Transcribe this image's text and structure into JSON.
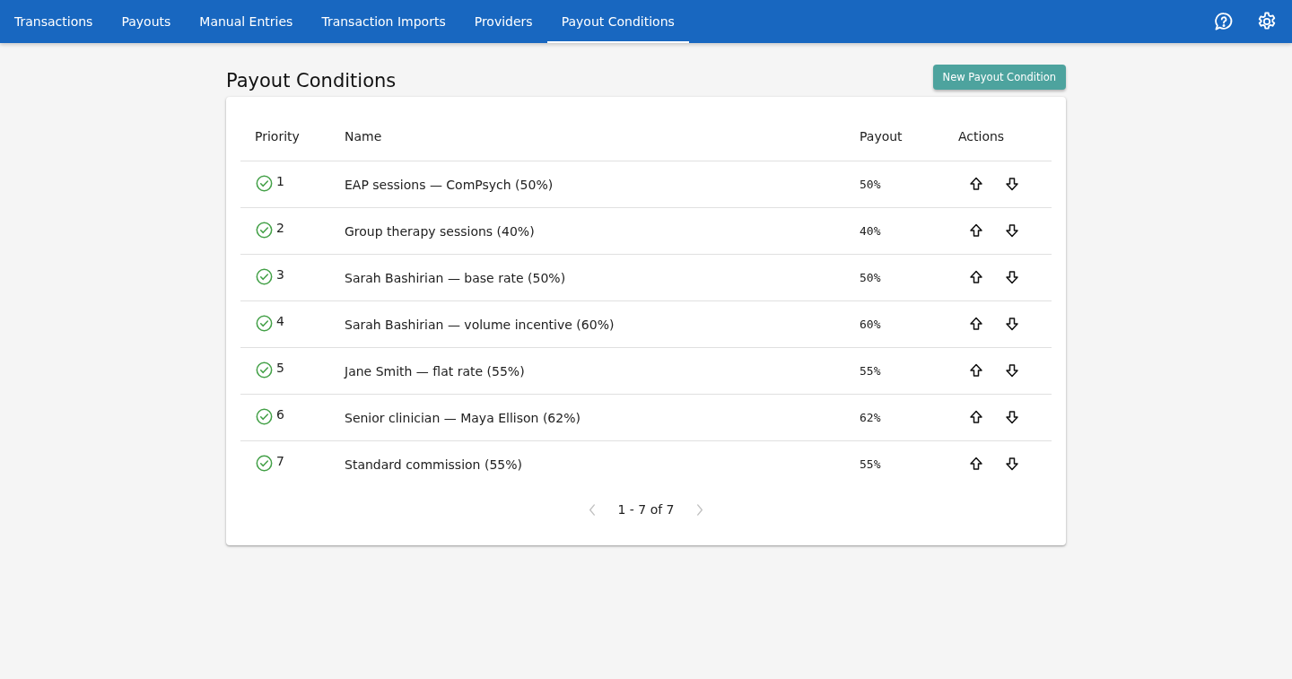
{
  "nav": {
    "tabs": [
      {
        "label": "Transactions",
        "selected": false
      },
      {
        "label": "Payouts",
        "selected": false
      },
      {
        "label": "Manual Entries",
        "selected": false
      },
      {
        "label": "Transaction Imports",
        "selected": false
      },
      {
        "label": "Providers",
        "selected": false
      },
      {
        "label": "Payout Conditions",
        "selected": true
      }
    ]
  },
  "page": {
    "title": "Payout Conditions",
    "new_button": "New Payout Condition"
  },
  "table": {
    "columns": [
      "Priority",
      "Name",
      "Payout",
      "Actions"
    ],
    "rows": [
      {
        "active": true,
        "priority": "1",
        "name": "EAP sessions — ComPsych (50%)",
        "payout": "50%"
      },
      {
        "active": true,
        "priority": "2",
        "name": "Group therapy sessions (40%)",
        "payout": "40%"
      },
      {
        "active": true,
        "priority": "3",
        "name": "Sarah Bashirian — base rate (50%)",
        "payout": "50%"
      },
      {
        "active": true,
        "priority": "4",
        "name": "Sarah Bashirian — volume incentive (60%)",
        "payout": "60%"
      },
      {
        "active": true,
        "priority": "5",
        "name": "Jane Smith — flat rate (55%)",
        "payout": "55%"
      },
      {
        "active": true,
        "priority": "6",
        "name": "Senior clinician — Maya Ellison (62%)",
        "payout": "62%"
      },
      {
        "active": true,
        "priority": "7",
        "name": "Standard commission (55%)",
        "payout": "55%"
      }
    ]
  },
  "pagination": {
    "range": "1 - 7 of 7",
    "prev_disabled": true,
    "next_disabled": true
  }
}
